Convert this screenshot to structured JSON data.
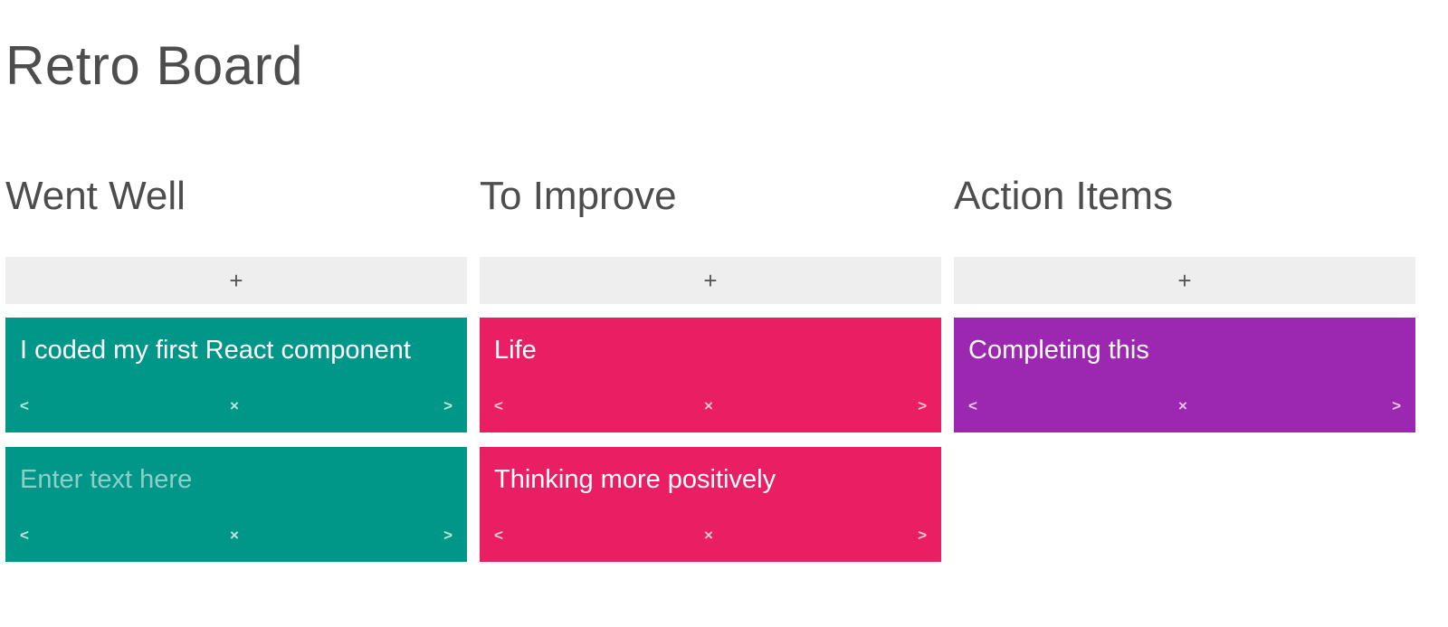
{
  "app": {
    "title": "Retro Board"
  },
  "colors": {
    "went_well": "#009688",
    "to_improve": "#e91e63",
    "action_items": "#9c27b0",
    "add_button_bg": "#eeeeee"
  },
  "icons": {
    "move_left": "<",
    "delete": "×",
    "move_right": ">",
    "add": "+"
  },
  "columns": [
    {
      "title": "Went Well",
      "add_label": "+",
      "cards": [
        {
          "text": "I coded my first React component"
        }
      ],
      "new_card": {
        "placeholder": "Enter text here"
      }
    },
    {
      "title": "To Improve",
      "add_label": "+",
      "cards": [
        {
          "text": "Life"
        },
        {
          "text": "Thinking more positively"
        }
      ]
    },
    {
      "title": "Action Items",
      "add_label": "+",
      "cards": [
        {
          "text": "Completing this"
        }
      ]
    }
  ]
}
